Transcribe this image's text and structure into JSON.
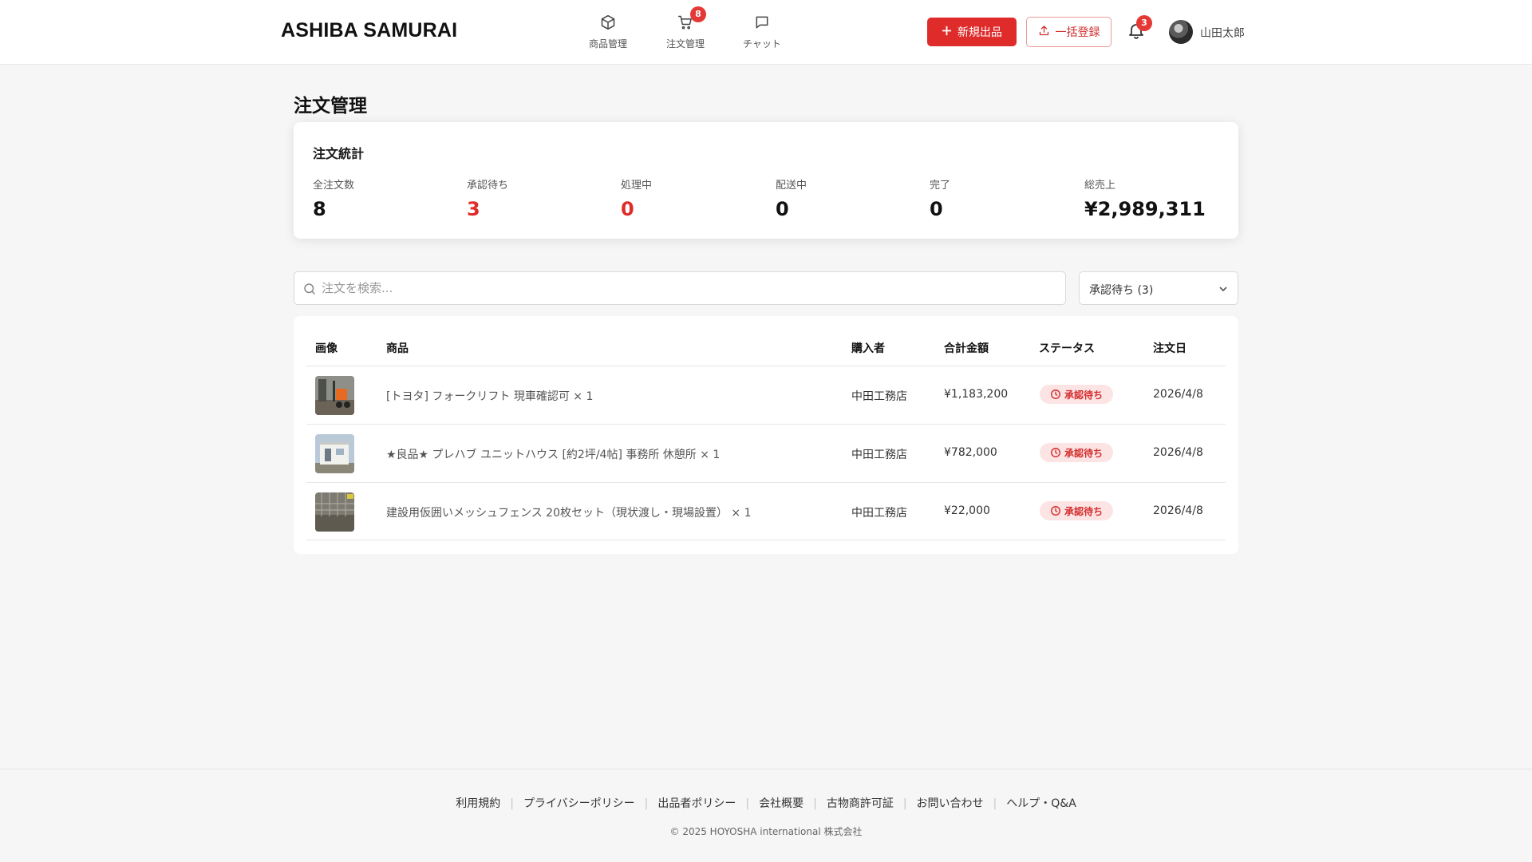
{
  "header": {
    "logo": "ASHIBA SAMURAI",
    "nav": [
      {
        "label": "商品管理",
        "icon": "box-icon"
      },
      {
        "label": "注文管理",
        "icon": "cart-icon",
        "badge": "8"
      },
      {
        "label": "チャット",
        "icon": "chat-icon"
      }
    ],
    "new_listing": "新規出品",
    "bulk_register": "一括登録",
    "notification_count": "3",
    "username": "山田太郎"
  },
  "page": {
    "title": "注文管理"
  },
  "stats": {
    "title": "注文統計",
    "items": [
      {
        "label": "全注文数",
        "value": "8",
        "color": "#111111"
      },
      {
        "label": "承認待ち",
        "value": "3",
        "color": "#e02b2b"
      },
      {
        "label": "処理中",
        "value": "0",
        "color": "#e02b2b"
      },
      {
        "label": "配送中",
        "value": "0",
        "color": "#111111"
      },
      {
        "label": "完了",
        "value": "0",
        "color": "#111111"
      },
      {
        "label": "総売上",
        "value": "¥2,989,311",
        "color": "#111111"
      }
    ]
  },
  "search": {
    "placeholder": "注文を検索...",
    "value": ""
  },
  "filter": {
    "selected": "承認待ち (3)"
  },
  "table": {
    "headers": [
      "画像",
      "商品",
      "購入者",
      "合計金額",
      "ステータス",
      "注文日"
    ],
    "rows": [
      {
        "product": "[トヨタ] フォークリフト 現車確認可 × 1",
        "buyer": "中田工務店",
        "total": "¥1,183,200",
        "status": "承認待ち",
        "date": "2026/4/8",
        "thumb": "forklift"
      },
      {
        "product": "★良品★ プレハブ ユニットハウス [約2坪/4帖] 事務所 休憩所 × 1",
        "buyer": "中田工務店",
        "total": "¥782,000",
        "status": "承認待ち",
        "date": "2026/4/8",
        "thumb": "prefab"
      },
      {
        "product": "建設用仮囲いメッシュフェンス 20枚セット（現状渡し・現場設置） × 1",
        "buyer": "中田工務店",
        "total": "¥22,000",
        "status": "承認待ち",
        "date": "2026/4/8",
        "thumb": "fence"
      }
    ]
  },
  "footer": {
    "links": [
      "利用規約",
      "プライバシーポリシー",
      "出品者ポリシー",
      "会社概要",
      "古物商許可証",
      "お問い合わせ",
      "ヘルプ・Q&A"
    ],
    "copyright": "© 2025 HOYOSHA international 株式会社"
  },
  "colors": {
    "accent": "#e02b2b",
    "badge_bg": "#fde4e4"
  }
}
